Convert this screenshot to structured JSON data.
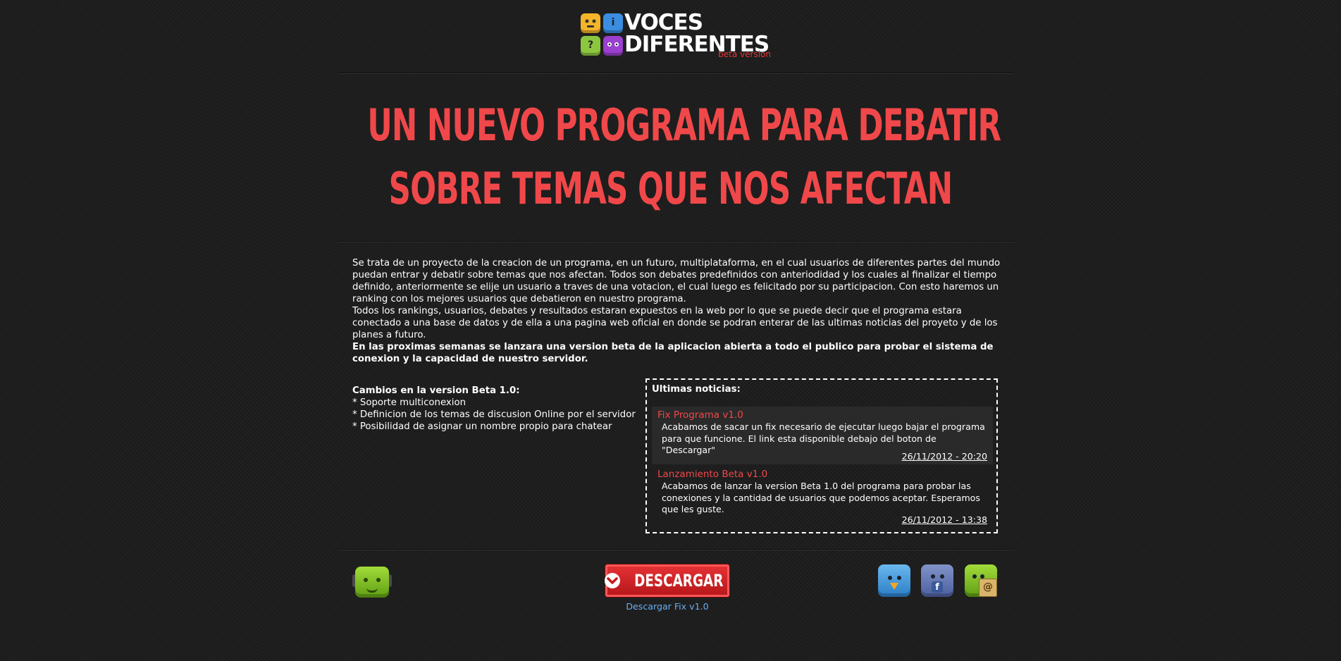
{
  "logo": {
    "line1": "VOCES",
    "line2": "DIFERENTES",
    "beta": "beta version",
    "icons": [
      "face-yellow-icon",
      "info-blue-icon",
      "question-green-icon",
      "face-purple-icon"
    ],
    "icon_glyphs": {
      "info": "i",
      "question": "?"
    }
  },
  "hero": {
    "line1": "UN NUEVO PROGRAMA PARA DEBATIR",
    "line2": "SOBRE TEMAS QUE NOS AFECTAN"
  },
  "intro": {
    "paragraph1": "Se trata de un proyecto de la creacion de un programa, en un futuro, multiplataforma, en el cual usuarios de diferentes partes del mundo puedan entrar y debatir sobre temas que nos afectan. Todos son debates predefinidos con anteriodidad y los cuales al finalizar el tiempo definido, anteriormente se elije un usuario a traves de una votacion, el cual luego es felicitado por su participacion. Con esto haremos un ranking con los mejores usuarios que debatieron en nuestro programa.",
    "paragraph2": "Todos los rankings, usuarios, debates y resultados estaran expuestos en la web por lo que se puede decir que el programa estara conectado a una base de datos y de ella a una pagina web oficial en donde se podran enterar de las ultimas noticias del proyeto y de los planes a futuro.",
    "paragraph3": "En las proximas semanas se lanzara una version beta de la aplicacion abierta a todo el publico para probar el sistema de conexion y la capacidad de nuestro servidor."
  },
  "changes": {
    "title": "Cambios en la version Beta 1.0:",
    "items": [
      "* Soporte multiconexion",
      "* Definicion de los temas de discusion Online por el servidor",
      "* Posibilidad de asignar un nombre propio para chatear"
    ]
  },
  "news": {
    "title": "Ultimas noticias:",
    "items": [
      {
        "heading": "Fix Programa v1.0",
        "body": "Acabamos de sacar un fix necesario de ejecutar luego bajar el programa para que funcione. El link esta disponible debajo del boton de \"Descargar\"",
        "date": "26/11/2012 - 20:20"
      },
      {
        "heading": "Lanzamiento Beta v1.0",
        "body": "Acabamos de lanzar la version Beta 1.0 del programa para probar las conexiones y la cantidad de usuarios que podemos aceptar. Esperamos que les guste.",
        "date": "26/11/2012 - 13:38"
      }
    ]
  },
  "footer": {
    "download_label": "DESCARGAR",
    "fix_link": "Descargar Fix v1.0",
    "social": [
      "twitter-icon",
      "facebook-icon",
      "contact-mail-icon"
    ],
    "social_glyphs": {
      "facebook": "f",
      "mail": "@"
    }
  },
  "colors": {
    "background": "#1e1e1e",
    "accent_red": "#f0484a",
    "button_red": "#e33134",
    "link_blue": "#6aaef0",
    "text": "#ffffff"
  }
}
